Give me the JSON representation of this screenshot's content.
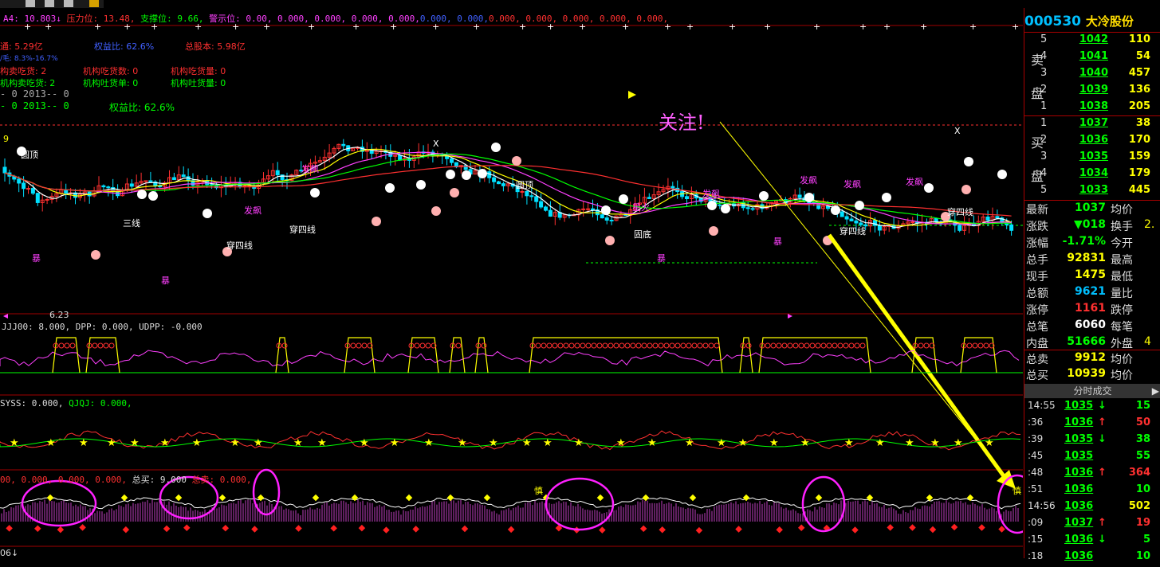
{
  "header": {
    "a4_label": "A4: 10.803↓",
    "pressure_label": "压力位: 13.48,",
    "support_label": "支撑位: 9.66,",
    "warn_label": "警示位: 0.00, 0.000, 0.000, 0.000, 0.000,",
    "blue_values": "0.000, 0.000,",
    "tail_values": "0.000, 0.000, 0.000, 0.000, 0.000,"
  },
  "info_lines": {
    "line1_a": "通: 5.29亿",
    "line1_b": "权益比: 62.6%",
    "line1_c": "总股本: 5.98亿",
    "line2": "/毛: 8.3%-16.7%",
    "line3_a": "构卖吃货: 2",
    "line3_b": "机构吃货数: 0",
    "line3_c": "机构吃货量: 0",
    "line4_a": "机构卖吃货: 2",
    "line4_b": "机构吐货单: 0",
    "line4_c": "机构吐货量: 0",
    "line5": "- 0    2013-- 0",
    "line6_a": "- 0    2013-- 0",
    "line6_b": "权益比: 62.6%"
  },
  "annotation": {
    "text": "关注!"
  },
  "chart_labels": {
    "yuanding1": "圆顶",
    "yuanding2": "圆顶",
    "fapiao": [
      "发飙",
      "发飙",
      "发飙",
      "发飙",
      "发飙",
      "发飙"
    ],
    "sanxian": "三线",
    "chuansixian": [
      "穿四线",
      "穿四线",
      "穿四线",
      "穿四线"
    ],
    "xinghuo": "星火",
    "gudi": "固底",
    "bao": [
      "暴",
      "暴",
      "暴",
      "暴"
    ],
    "xxx": [
      "X",
      "X"
    ],
    "low_price": "6.23",
    "k_top": "9"
  },
  "indicators": {
    "ind1": "JJJ00: 8.000, DPP: 0.000, UDPP: -0.000",
    "ind2_a": "SYSS: 0.000,",
    "ind2_b": "QJQJ: 0.000,",
    "ind3_a": "00, 0.000, 0.000, 0.000,",
    "ind3_b": "总买: 9.000",
    "ind3_c": "总卖: 0.000,",
    "ind3_d": "慎",
    "ind3_e": "慎",
    "bottom_label": "06↓"
  },
  "panel": {
    "code": "000530",
    "name": "大冷股份",
    "sell_label": [
      "卖",
      "盘"
    ],
    "buy_label": [
      "买",
      "盘"
    ],
    "sell_book": [
      {
        "level": "5",
        "price": "1042",
        "vol": "110"
      },
      {
        "level": "4",
        "price": "1041",
        "vol": "54"
      },
      {
        "level": "3",
        "price": "1040",
        "vol": "457"
      },
      {
        "level": "2",
        "price": "1039",
        "vol": "136"
      },
      {
        "level": "1",
        "price": "1038",
        "vol": "205"
      }
    ],
    "buy_book": [
      {
        "level": "1",
        "price": "1037",
        "vol": "38"
      },
      {
        "level": "2",
        "price": "1036",
        "vol": "170"
      },
      {
        "level": "3",
        "price": "1035",
        "vol": "159"
      },
      {
        "level": "4",
        "price": "1034",
        "vol": "179"
      },
      {
        "level": "5",
        "price": "1033",
        "vol": "445"
      }
    ],
    "quotes": [
      {
        "l1": "最新",
        "v1": "1037",
        "c1": "#00ff00",
        "l2": "均价",
        "v2": ""
      },
      {
        "l1": "涨跌",
        "v1": "▼018",
        "c1": "#00ff00",
        "l2": "换手",
        "v2": "2."
      },
      {
        "l1": "涨幅",
        "v1": "-1.71%",
        "c1": "#00ff00",
        "l2": "今开",
        "v2": ""
      },
      {
        "l1": "总手",
        "v1": "92831",
        "c1": "#ffff00",
        "l2": "最高",
        "v2": ""
      },
      {
        "l1": "现手",
        "v1": "1475",
        "c1": "#ffff00",
        "l2": "最低",
        "v2": ""
      },
      {
        "l1": "总额",
        "v1": "9621",
        "c1": "#00c0ff",
        "l2": "量比",
        "v2": ""
      },
      {
        "l1": "涨停",
        "v1": "1161",
        "c1": "#ff3030",
        "l2": "跌停",
        "v2": ""
      },
      {
        "l1": "总笔",
        "v1": "6060",
        "c1": "#ffffff",
        "l2": "每笔",
        "v2": ""
      },
      {
        "l1": "内盘",
        "v1": "51666",
        "c1": "#00ff00",
        "l2": "外盘",
        "v2": "4"
      }
    ],
    "totals": [
      {
        "l1": "总卖",
        "v1": "9912",
        "c1": "#ffff00",
        "l2": "均价"
      },
      {
        "l1": "总买",
        "v1": "10939",
        "c1": "#ffff00",
        "l2": "均价"
      }
    ],
    "tick_header": "分时成交",
    "ticks": [
      {
        "time": "14:55",
        "price": "1035",
        "arrow": "↓",
        "ac": "#00ff00",
        "vol": "15",
        "vc": "#00ff00"
      },
      {
        "time": ":36",
        "price": "1036",
        "arrow": "↑",
        "ac": "#ff3030",
        "vol": "50",
        "vc": "#ff3030"
      },
      {
        "time": ":39",
        "price": "1035",
        "arrow": "↓",
        "ac": "#00ff00",
        "vol": "38",
        "vc": "#00ff00"
      },
      {
        "time": ":45",
        "price": "1035",
        "arrow": "",
        "ac": "#00ff00",
        "vol": "55",
        "vc": "#00ff00"
      },
      {
        "time": ":48",
        "price": "1036",
        "arrow": "↑",
        "ac": "#ff3030",
        "vol": "364",
        "vc": "#ff3030"
      },
      {
        "time": ":51",
        "price": "1036",
        "arrow": "",
        "ac": "#00ff00",
        "vol": "10",
        "vc": "#00ff00"
      },
      {
        "time": "14:56",
        "price": "1036",
        "arrow": "",
        "ac": "#00ff00",
        "vol": "502",
        "vc": "#ffff00"
      },
      {
        "time": ":09",
        "price": "1037",
        "arrow": "↑",
        "ac": "#ff3030",
        "vol": "19",
        "vc": "#ff3030"
      },
      {
        "time": ":15",
        "price": "1036",
        "arrow": "↓",
        "ac": "#00ff00",
        "vol": "5",
        "vc": "#00ff00"
      },
      {
        "time": ":18",
        "price": "1036",
        "arrow": "",
        "ac": "#00ff00",
        "vol": "10",
        "vc": "#00ff00"
      }
    ]
  },
  "colors": {
    "up": "#ff3030",
    "down": "#00ff00",
    "accent_yellow": "#ffff00",
    "magenta": "#ff40ff",
    "cyan": "#00c0ff",
    "grid_red": "#a00000"
  }
}
